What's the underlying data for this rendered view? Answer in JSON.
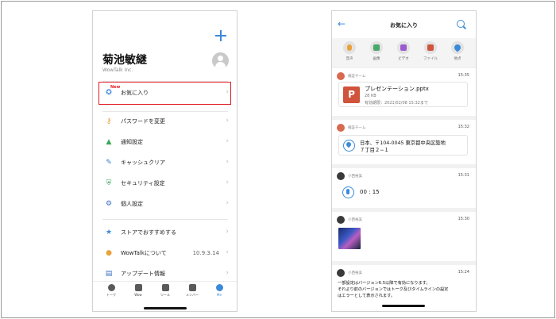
{
  "left_screen": {
    "user_name": "菊池敏継",
    "company": "WowTalk Inc.",
    "new_badge": "New",
    "menu_items": [
      {
        "label": "お気に入り",
        "color": "#3b8ad9"
      },
      {
        "label": "パスワードを変更",
        "color": "#e8a23a"
      },
      {
        "label": "通知設定",
        "color": "#3aa75a"
      },
      {
        "label": "キャッシュクリア",
        "color": "#3b7bd9"
      },
      {
        "label": "セキュリティ設定",
        "color": "#3aa75a"
      },
      {
        "label": "個人設定",
        "color": "#3b6fc4"
      },
      {
        "label": "ストアでおすすめする",
        "color": "#3b8ad9"
      },
      {
        "label": "WowTalkについて",
        "value": "10.9.3.14",
        "color": "#e8a23a"
      },
      {
        "label": "アップデート情報",
        "color": "#3b6fc4"
      }
    ],
    "tabs": [
      {
        "label": "トーク"
      },
      {
        "label": "Wow"
      },
      {
        "label": "ツール"
      },
      {
        "label": "メンバー"
      },
      {
        "label": "Me"
      }
    ]
  },
  "right_screen": {
    "title": "お気に入り",
    "filters": [
      {
        "label": "音声",
        "color": "#e8a23a"
      },
      {
        "label": "画像",
        "color": "#4aa86a"
      },
      {
        "label": "ビデオ",
        "color": "#9b59d0"
      },
      {
        "label": "ファイル",
        "color": "#d0533c"
      },
      {
        "label": "地点",
        "color": "#3b8ad9"
      }
    ],
    "items": [
      {
        "sender": "検証チーム",
        "time": "15:35",
        "file_icon_letter": "P",
        "file_name": "プレゼンテーション.pptx",
        "file_size": "28 KB",
        "expiry": "有効期限：2021/02/08 15:32まで"
      },
      {
        "sender": "検証チーム",
        "time": "15:32",
        "address_line1": "日本、〒104-0045 東京都中央区築地",
        "address_line2": "７丁目２−１"
      },
      {
        "sender": "小西裕美",
        "time": "15:31",
        "duration": "00 : 15"
      },
      {
        "sender": "小西裕美",
        "time": "15:30"
      },
      {
        "sender": "小西裕美",
        "time": "15:24",
        "text_line1": "一部設定はバージョン6.5以降で有効になります。",
        "text_line2": "それより前のバージョンではトーク及びタイムラインの設定",
        "text_line3": "はエラーとして表示されます。"
      }
    ]
  }
}
